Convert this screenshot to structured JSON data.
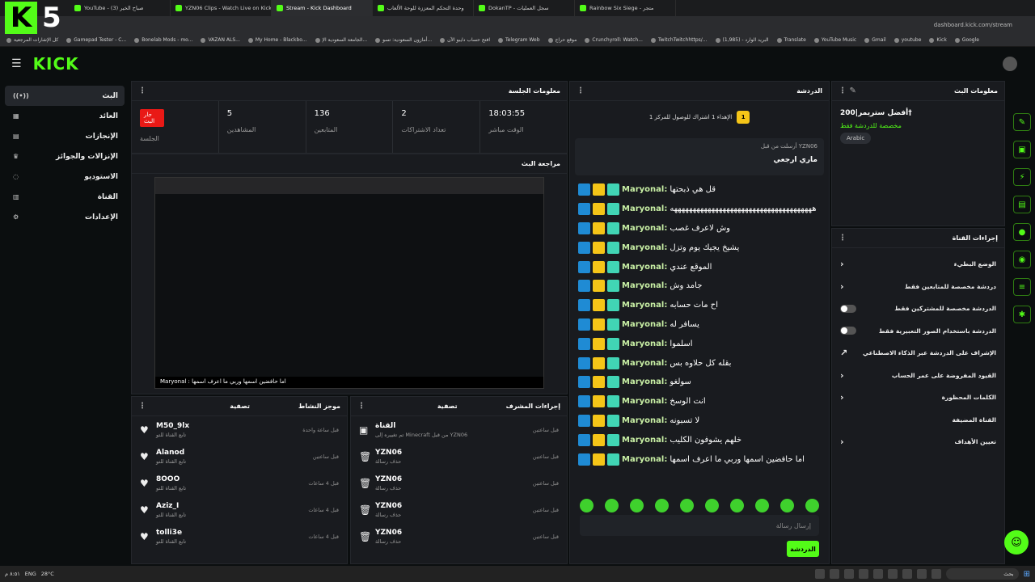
{
  "browser": {
    "tabs": [
      {
        "label": "YouTube - صباح الخير (3)",
        "active": false
      },
      {
        "label": "YZN06 Clips - Watch Live on Kick",
        "active": false
      },
      {
        "label": "Stream - Kick Dashboard",
        "active": true
      },
      {
        "label": "وحدة التحكم المعززة للوحة الألعاب",
        "active": false
      },
      {
        "label": "DokanTP - سجل العمليات",
        "active": false
      },
      {
        "label": "Rainbow Six Siege - متجر",
        "active": false
      }
    ],
    "url": "dashboard.kick.com/stream",
    "bookmarks": [
      "كل الإشارات المرجعية",
      "Gamepad Tester - C...",
      "Bonelab Mods - mo...",
      "VAZAN ALS...",
      "My Home - Blackbo...",
      "الجامعة السعودية الإ...",
      "أمازون السعودية: تسو...",
      "افتح حساب دايبو الآن",
      "Telegram Web",
      "موقع حراج",
      "Crunchyroll: Watch...",
      "TwitchTwitchhttps/...",
      "(1,985) - البريد الوارد",
      "Translate",
      "YouTube Music",
      "Gmail",
      "youtube",
      "Kick",
      "Google"
    ]
  },
  "overlay": {
    "badge_letter": "K",
    "badge_number": "5"
  },
  "header": {
    "logo": "KICK"
  },
  "sidebar": {
    "items": [
      {
        "label": "البث",
        "icon": "broadcast-icon",
        "active": true
      },
      {
        "label": "العائد",
        "icon": "money-icon",
        "active": false
      },
      {
        "label": "الإنجازات",
        "icon": "achievements-icon",
        "active": false
      },
      {
        "label": "الإنزالات والجوائز",
        "icon": "trophy-icon",
        "active": false
      },
      {
        "label": "الاستوديو",
        "icon": "studio-icon",
        "active": false
      },
      {
        "label": "القناة",
        "icon": "channel-icon",
        "active": false
      },
      {
        "label": "الإعدادات",
        "icon": "gear-icon",
        "active": false
      }
    ]
  },
  "session": {
    "title": "معلومات الجلسة",
    "live_badge": "جار البث",
    "stats": [
      {
        "label": "الجلسة",
        "value": ""
      },
      {
        "label": "المشاهدين",
        "value": "5"
      },
      {
        "label": "المتابعين",
        "value": "136"
      },
      {
        "label": "تعداد الاشتراكات",
        "value": "2"
      },
      {
        "label": "الوقت مباشر",
        "value": "18:03:55"
      }
    ]
  },
  "preview": {
    "title": "مراجعة البث",
    "overlay_chat": "Maryonal : اما حافضين اسمها وربي ما اعرف اسمها"
  },
  "activity": {
    "title": "موجز النشاط",
    "filter": "تصفية",
    "items": [
      {
        "user": "M50_9lx",
        "action": "تابع القناة للتو",
        "time": "قبل ساعة واحدة"
      },
      {
        "user": "Alanod",
        "action": "تابع القناة للتو",
        "time": "قبل ساعتين"
      },
      {
        "user": "8OOO",
        "action": "تابع القناة للتو",
        "time": "قبل 4 ساعات"
      },
      {
        "user": "Aziz_I",
        "action": "تابع القناة للتو",
        "time": "قبل 4 ساعات"
      },
      {
        "user": "tolli3e",
        "action": "تابع القناة للتو",
        "time": "قبل 4 ساعات"
      }
    ]
  },
  "mod_actions": {
    "title": "إجراءات المشرف",
    "filter": "تصفية",
    "items": [
      {
        "user": "القناة",
        "action": "تم تغييره إلى Minecraft من قبل YZN06",
        "time": "قبل ساعتين"
      },
      {
        "user": "YZN06",
        "action": "حذف رسالة",
        "time": "قبل ساعتين"
      },
      {
        "user": "YZN06",
        "action": "حذف رسالة",
        "time": "قبل ساعتين"
      },
      {
        "user": "YZN06",
        "action": "حذف رسالة",
        "time": "قبل ساعتين"
      },
      {
        "user": "YZN06",
        "action": "حذف رسالة",
        "time": "قبل ساعتين"
      }
    ]
  },
  "chat": {
    "title": "الدردشة",
    "goal_text": "الإهداء 1 اشتراك للوصول للمركز 1",
    "goal_rank": "1",
    "pinned_by": "أرسلت من قبل YZN06",
    "pinned_text": "ماري ارجعي",
    "messages": [
      {
        "user": "Maryonal:",
        "text": "قل هي ذبحتها"
      },
      {
        "user": "Maryonal:",
        "text": "ههههههههههههههههههههههههههههههههههههههه"
      },
      {
        "user": "Maryonal:",
        "text": "وش لاعرف غصب"
      },
      {
        "user": "Maryonal:",
        "text": "يشيخ يجيك يوم وتزل"
      },
      {
        "user": "Maryonal:",
        "text": "الموقع عندي"
      },
      {
        "user": "Maryonal:",
        "text": "جامد وش"
      },
      {
        "user": "Maryonal:",
        "text": "اح مات حسابه"
      },
      {
        "user": "Maryonal:",
        "text": "يسافر له"
      },
      {
        "user": "Maryonal:",
        "text": "اسلموا"
      },
      {
        "user": "Maryonal:",
        "text": "بقله كل حلاوه بس"
      },
      {
        "user": "Maryonal:",
        "text": "سولغو"
      },
      {
        "user": "Maryonal:",
        "text": "انت الوسخ"
      },
      {
        "user": "Maryonal:",
        "text": "لا تسبونه"
      },
      {
        "user": "Maryonal:",
        "text": "خلهم يشوفون الكليب"
      },
      {
        "user": "Maryonal:",
        "text": "اما حافضين اسمها وربي ما اعرف اسمها"
      }
    ],
    "input_placeholder": "إرسال رسالة",
    "send_label": "الدردشة"
  },
  "stream_info": {
    "title": "معلومات البث",
    "stream_title": "أفضل ستريمر|200†",
    "subtitle": "مخصصة للدردشة فقط",
    "language": "Arabic"
  },
  "channel_actions": {
    "title": "إجراءات القناة",
    "items": [
      {
        "label": "الوضع البطيء",
        "control": "chevron"
      },
      {
        "label": "دردشة مخصصة للمتابعين فقط",
        "control": "chevron"
      },
      {
        "label": "الدردشة مخصصة للمشتركين فقط",
        "control": "toggle"
      },
      {
        "label": "الدردشة باستخدام الصور التعبيرية فقط",
        "control": "toggle"
      },
      {
        "label": "الإشراف على الدردشة عبر الذكاء الاصطناعي",
        "control": "external"
      },
      {
        "label": "القيود المفروضة على عمر الحساب",
        "control": "chevron"
      },
      {
        "label": "الكلمات المحظورة",
        "control": "chevron"
      },
      {
        "label": "القناة المضيفة",
        "control": "none"
      },
      {
        "label": "تعيين الأهداف",
        "control": "chevron"
      }
    ]
  },
  "taskbar": {
    "weather": "28°C",
    "lang": "ENG",
    "time": "٨:٥١ م",
    "search": "بحث"
  },
  "colors": {
    "accent": "#53fc18",
    "live": "#e91916",
    "panel": "#191b1f"
  }
}
